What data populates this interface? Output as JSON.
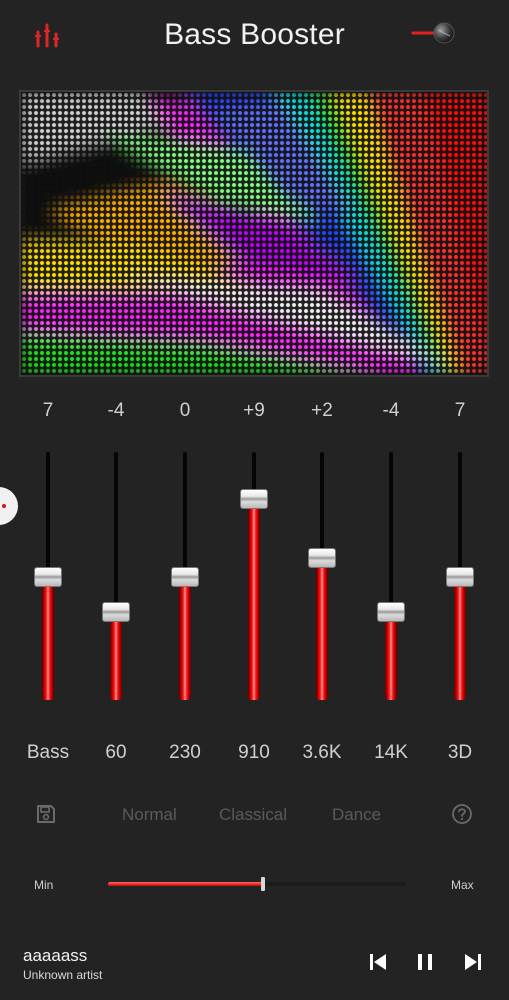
{
  "header": {
    "title": "Bass Booster",
    "equalizer_icon": "equalizer-bars-icon",
    "power_icon": "power-toggle-icon",
    "accent": "#e62020"
  },
  "equalizer": {
    "bands": [
      {
        "value": "7",
        "label": "Bass",
        "level": 0.49
      },
      {
        "value": "-4",
        "label": "60",
        "level": 0.35
      },
      {
        "value": "0",
        "label": "230",
        "level": 0.49
      },
      {
        "value": "+9",
        "label": "910",
        "level": 0.81
      },
      {
        "value": "+2",
        "label": "3.6K",
        "level": 0.57
      },
      {
        "value": "-4",
        "label": "14K",
        "level": 0.35
      },
      {
        "value": "7",
        "label": "3D",
        "level": 0.49
      }
    ]
  },
  "presets": {
    "save_icon": "save-icon",
    "items": [
      "Normal",
      "Classical",
      "Dance"
    ],
    "help_icon": "help-icon"
  },
  "boost": {
    "min_label": "Min",
    "max_label": "Max",
    "level": 0.52
  },
  "player": {
    "title": "aaaaass",
    "artist": "Unknown artist",
    "controls": [
      "skip-previous-icon",
      "pause-icon",
      "skip-next-icon"
    ]
  }
}
